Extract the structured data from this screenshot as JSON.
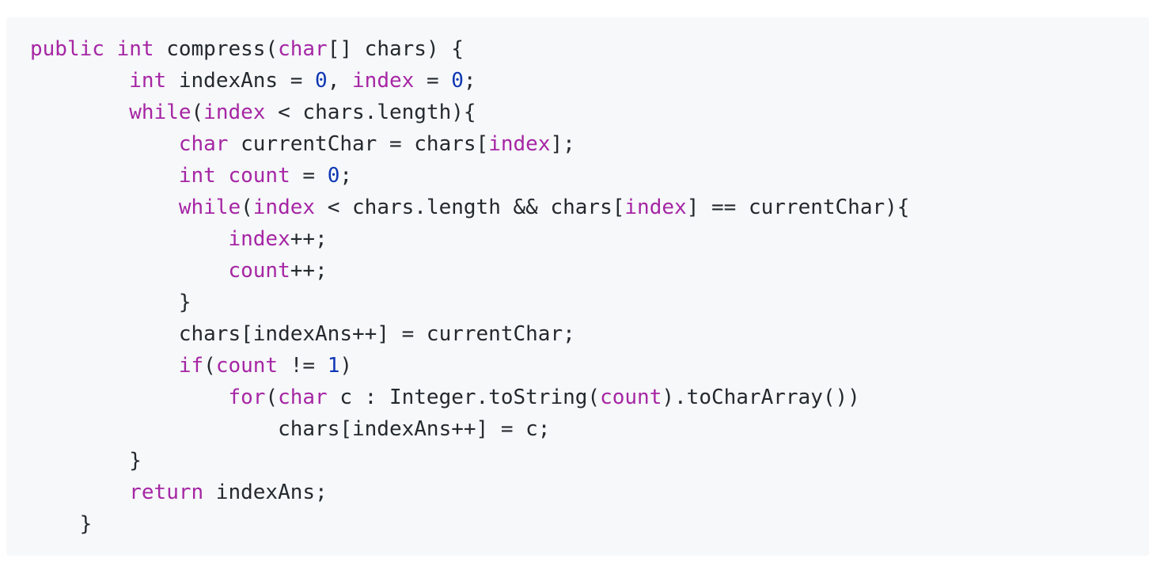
{
  "code": {
    "language": "java",
    "colors": {
      "background": "#f6f8fa",
      "plain": "#24292e",
      "keyword": "#a626a4",
      "number": "#0f37b3"
    },
    "lines": [
      {
        "indent": "",
        "tokens": [
          {
            "t": "kw",
            "v": "public"
          },
          {
            "t": "pl",
            "v": " "
          },
          {
            "t": "ty",
            "v": "int"
          },
          {
            "t": "pl",
            "v": " compress("
          },
          {
            "t": "ty",
            "v": "char"
          },
          {
            "t": "pl",
            "v": "[] chars) {"
          }
        ]
      },
      {
        "indent": "        ",
        "tokens": [
          {
            "t": "ty",
            "v": "int"
          },
          {
            "t": "pl",
            "v": " indexAns = "
          },
          {
            "t": "nm",
            "v": "0"
          },
          {
            "t": "pl",
            "v": ", "
          },
          {
            "t": "id",
            "v": "index"
          },
          {
            "t": "pl",
            "v": " = "
          },
          {
            "t": "nm",
            "v": "0"
          },
          {
            "t": "pl",
            "v": ";"
          }
        ]
      },
      {
        "indent": "        ",
        "tokens": [
          {
            "t": "kw",
            "v": "while"
          },
          {
            "t": "pl",
            "v": "("
          },
          {
            "t": "id",
            "v": "index"
          },
          {
            "t": "pl",
            "v": " < chars.length){"
          }
        ]
      },
      {
        "indent": "            ",
        "tokens": [
          {
            "t": "ty",
            "v": "char"
          },
          {
            "t": "pl",
            "v": " currentChar = chars["
          },
          {
            "t": "id",
            "v": "index"
          },
          {
            "t": "pl",
            "v": "];"
          }
        ]
      },
      {
        "indent": "            ",
        "tokens": [
          {
            "t": "ty",
            "v": "int"
          },
          {
            "t": "pl",
            "v": " "
          },
          {
            "t": "id",
            "v": "count"
          },
          {
            "t": "pl",
            "v": " = "
          },
          {
            "t": "nm",
            "v": "0"
          },
          {
            "t": "pl",
            "v": ";"
          }
        ]
      },
      {
        "indent": "            ",
        "tokens": [
          {
            "t": "kw",
            "v": "while"
          },
          {
            "t": "pl",
            "v": "("
          },
          {
            "t": "id",
            "v": "index"
          },
          {
            "t": "pl",
            "v": " < chars.length && chars["
          },
          {
            "t": "id",
            "v": "index"
          },
          {
            "t": "pl",
            "v": "] == currentChar){"
          }
        ]
      },
      {
        "indent": "                ",
        "tokens": [
          {
            "t": "id",
            "v": "index"
          },
          {
            "t": "pl",
            "v": "++;"
          }
        ]
      },
      {
        "indent": "                ",
        "tokens": [
          {
            "t": "id",
            "v": "count"
          },
          {
            "t": "pl",
            "v": "++;"
          }
        ]
      },
      {
        "indent": "            ",
        "tokens": [
          {
            "t": "pl",
            "v": "}"
          }
        ]
      },
      {
        "indent": "            ",
        "tokens": [
          {
            "t": "pl",
            "v": "chars[indexAns++] = currentChar;"
          }
        ]
      },
      {
        "indent": "            ",
        "tokens": [
          {
            "t": "kw",
            "v": "if"
          },
          {
            "t": "pl",
            "v": "("
          },
          {
            "t": "id",
            "v": "count"
          },
          {
            "t": "pl",
            "v": " != "
          },
          {
            "t": "nm",
            "v": "1"
          },
          {
            "t": "pl",
            "v": ")"
          }
        ]
      },
      {
        "indent": "                ",
        "tokens": [
          {
            "t": "kw",
            "v": "for"
          },
          {
            "t": "pl",
            "v": "("
          },
          {
            "t": "ty",
            "v": "char"
          },
          {
            "t": "pl",
            "v": " c : Integer.toString("
          },
          {
            "t": "id",
            "v": "count"
          },
          {
            "t": "pl",
            "v": ").toCharArray())"
          }
        ]
      },
      {
        "indent": "                    ",
        "tokens": [
          {
            "t": "pl",
            "v": "chars[indexAns++] = c;"
          }
        ]
      },
      {
        "indent": "        ",
        "tokens": [
          {
            "t": "pl",
            "v": "}"
          }
        ]
      },
      {
        "indent": "        ",
        "tokens": [
          {
            "t": "kw",
            "v": "return"
          },
          {
            "t": "pl",
            "v": " indexAns;"
          }
        ]
      },
      {
        "indent": "    ",
        "tokens": [
          {
            "t": "pl",
            "v": "}"
          }
        ]
      }
    ]
  }
}
